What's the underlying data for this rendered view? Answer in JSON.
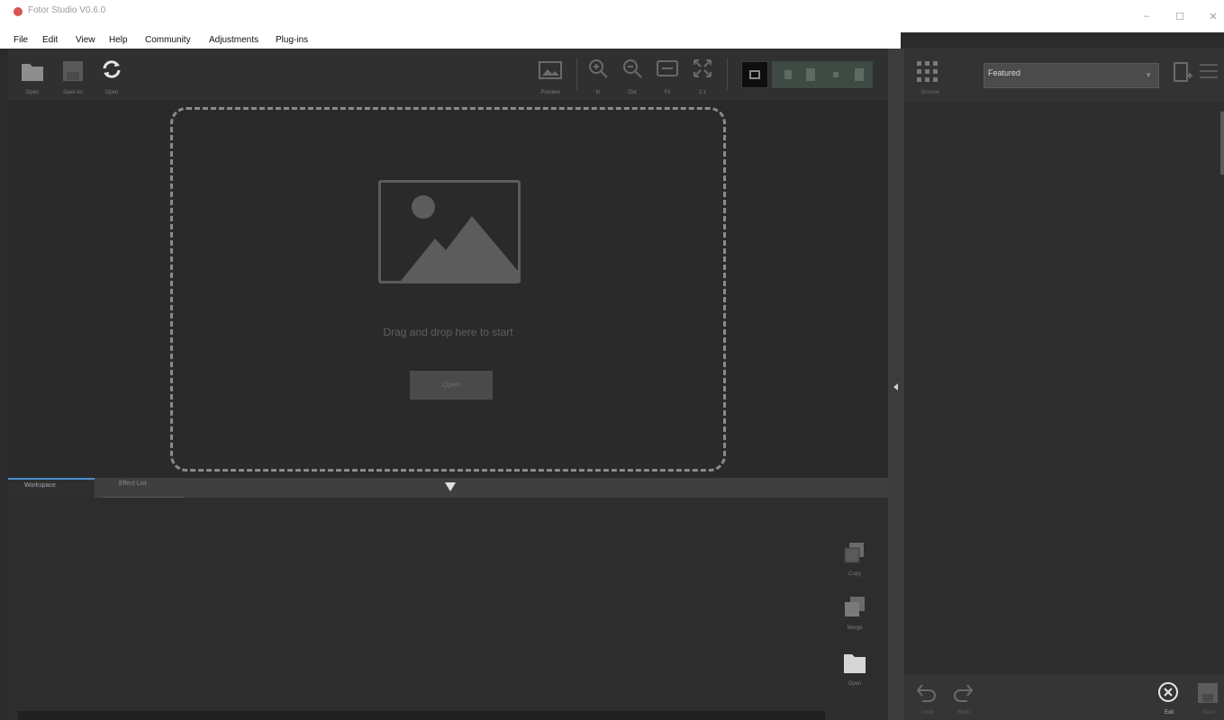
{
  "window": {
    "title": "Fotor Studio V0.6.0",
    "controls": {
      "minimize": "–",
      "maximize": "☐",
      "close": "✕"
    }
  },
  "menu": [
    "File",
    "Edit",
    "View",
    "Help",
    "Community",
    "Adjustments",
    "Plug-ins"
  ],
  "toolbar": {
    "left": [
      {
        "icon": "folder-icon",
        "label": "Open"
      },
      {
        "icon": "save-icon",
        "label": "Save As"
      },
      {
        "icon": "refresh-icon",
        "label": "Open"
      }
    ],
    "right": [
      {
        "icon": "image-icon",
        "label": "Preview"
      },
      {
        "icon": "zoom-in-icon",
        "label": "In"
      },
      {
        "icon": "zoom-out-icon",
        "label": "Out"
      },
      {
        "icon": "fit-icon",
        "label": "Fit"
      },
      {
        "icon": "fullscreen-icon",
        "label": "1:1"
      }
    ]
  },
  "canvas": {
    "drop_text": "Drag and drop here to start",
    "open_button": "Open"
  },
  "tabs": [
    {
      "label": "Workspace",
      "active": true
    },
    {
      "label": "Effect List",
      "active": false
    }
  ],
  "workspace_actions": [
    {
      "icon": "copy-icon",
      "label": "Copy"
    },
    {
      "icon": "stack-icon",
      "label": "Merge"
    },
    {
      "icon": "folder-icon",
      "label": "Open"
    }
  ],
  "right_panel": {
    "grid_icon_label": "Browse",
    "preset": "Featured",
    "bottom": [
      {
        "icon": "undo-icon",
        "label": "Undo"
      },
      {
        "icon": "redo-icon",
        "label": "Redo"
      },
      {
        "icon": "exit-icon",
        "label": "Exit"
      },
      {
        "icon": "save-icon",
        "label": "Save"
      }
    ]
  },
  "colors": {
    "accent": "#4a8fd0",
    "bg": "#2a2a2a",
    "logo": "#d9534f"
  }
}
